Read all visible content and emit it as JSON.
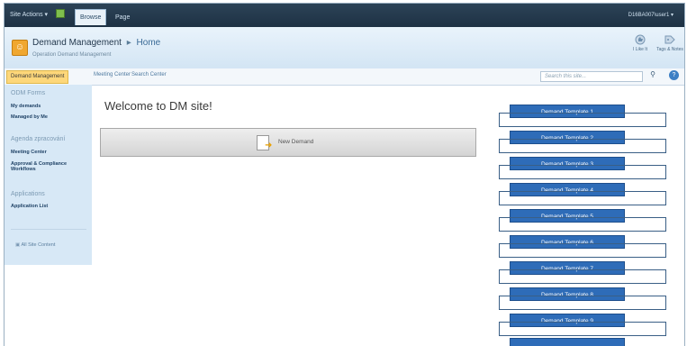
{
  "ribbon": {
    "site_actions": "Site Actions ▾",
    "tabs": [
      "Browse",
      "Page"
    ],
    "user": "D16BA007\\user1 ▾"
  },
  "header": {
    "site_title": "Demand Management",
    "breadcrumb_sep": "▸",
    "breadcrumb_home": "Home",
    "description": "Operation Demand Management",
    "like_label": "I Like It",
    "tags_label": "Tags & Notes"
  },
  "topnav": {
    "items": [
      "Demand Management",
      "Meeting Center",
      "Search Center"
    ],
    "search_placeholder": "Search this site...",
    "help_label": "?"
  },
  "leftnav": {
    "sections": [
      {
        "header": "ODM Forms",
        "items": [
          "My demands",
          "Managed by Me"
        ]
      },
      {
        "header": "Agenda zpracování",
        "items": [
          "Meeting Center",
          "Approval & Compliance Workflows"
        ]
      },
      {
        "header": "Applications",
        "items": [
          "Application List"
        ]
      }
    ],
    "all_site_content": "All Site Content"
  },
  "main": {
    "welcome": "Welcome to DM site!",
    "new_demand_label": "New Demand"
  },
  "templates": [
    "Demand Template 1",
    "Demand Template 2",
    "Demand Template 3",
    "Demand Template 4",
    "Demand Template 5",
    "Demand Template 6",
    "Demand Template 7",
    "Demand Template 8",
    "Demand Template 9",
    ""
  ],
  "colors": {
    "ribbon": "#1e3144",
    "accent": "#2e6cb8",
    "active_tab": "#fdd77a",
    "leftnav": "#d7e8f6"
  }
}
